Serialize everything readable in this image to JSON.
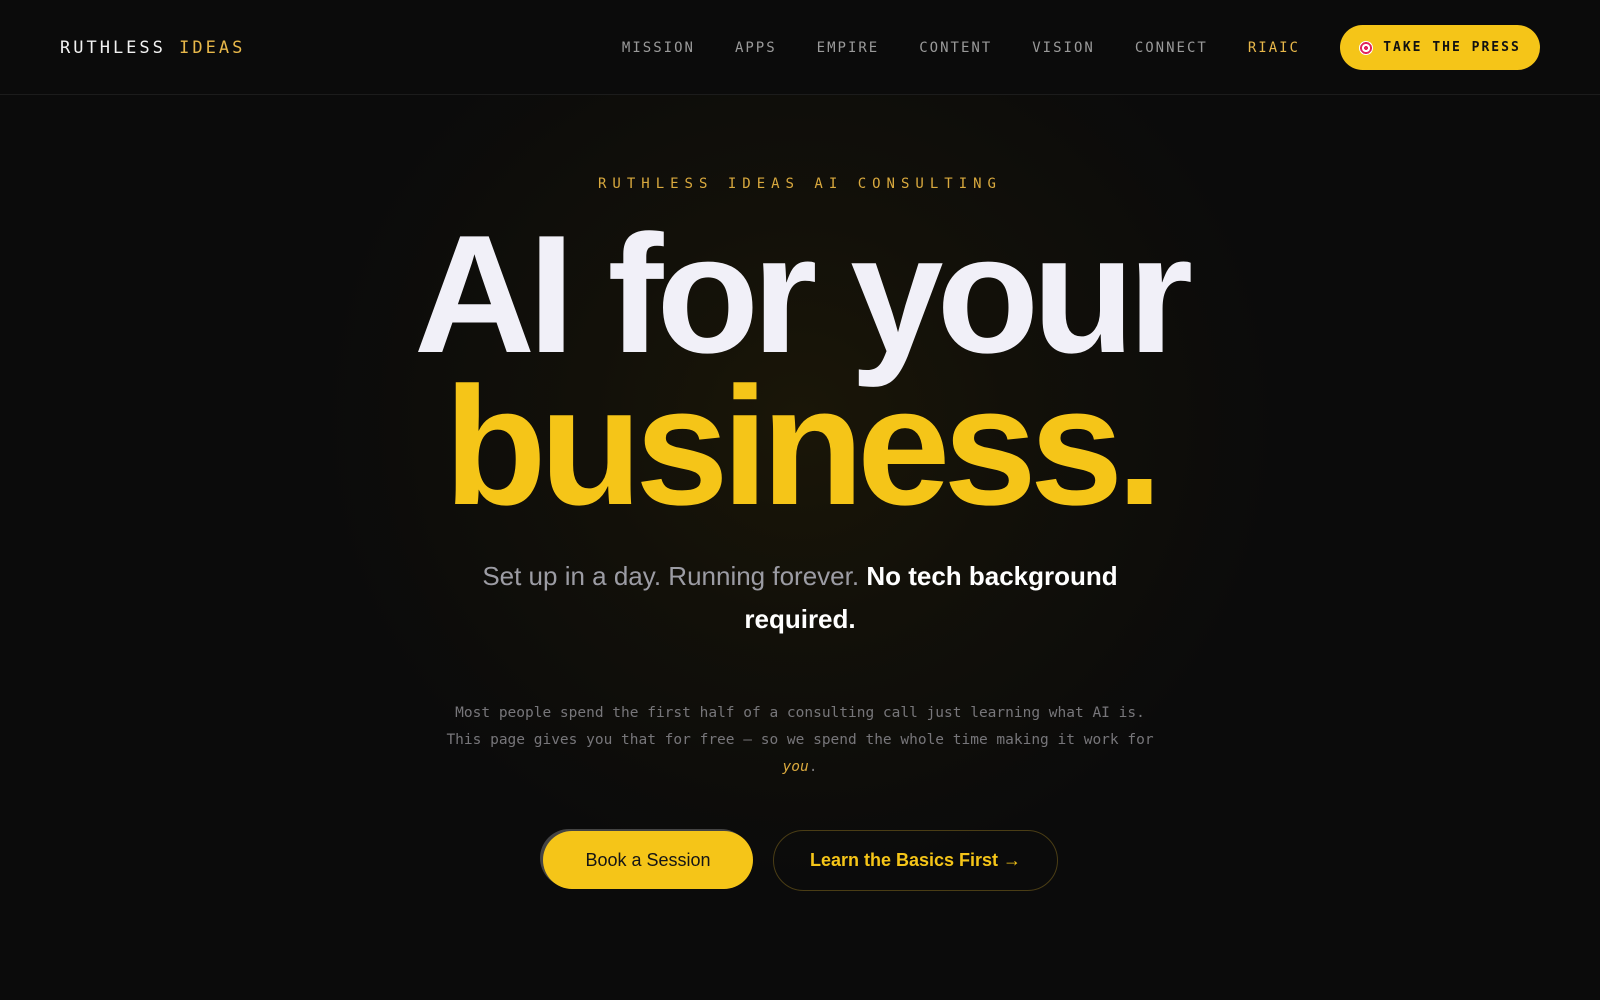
{
  "nav": {
    "brand_primary": "RUTHLESS",
    "brand_accent": "IDEAS",
    "links": [
      {
        "label": "MISSION"
      },
      {
        "label": "APPS"
      },
      {
        "label": "EMPIRE"
      },
      {
        "label": "CONTENT"
      },
      {
        "label": "VISION"
      },
      {
        "label": "CONNECT"
      },
      {
        "label": "RIAIC"
      }
    ],
    "cta_label": "TAKE THE PRESS",
    "cta_icon": "target-icon"
  },
  "hero": {
    "eyebrow": "RUTHLESS IDEAS AI CONSULTING",
    "headline_line1": "AI for your",
    "headline_line2": "business.",
    "subhead_regular": "Set up in a day. Running forever.",
    "subhead_bold": "No tech background required.",
    "body_main": "Most people spend the first half of a consulting call just learning what AI is. This page gives you that for free — so we spend the whole time making it work for",
    "body_emphasis": "you",
    "body_end": ".",
    "primary_button": "Book a Session",
    "secondary_button": "Learn the Basics First →"
  },
  "colors": {
    "accent": "#f5c518",
    "background": "#0b0b0b",
    "muted_gold": "#e8b84a"
  }
}
